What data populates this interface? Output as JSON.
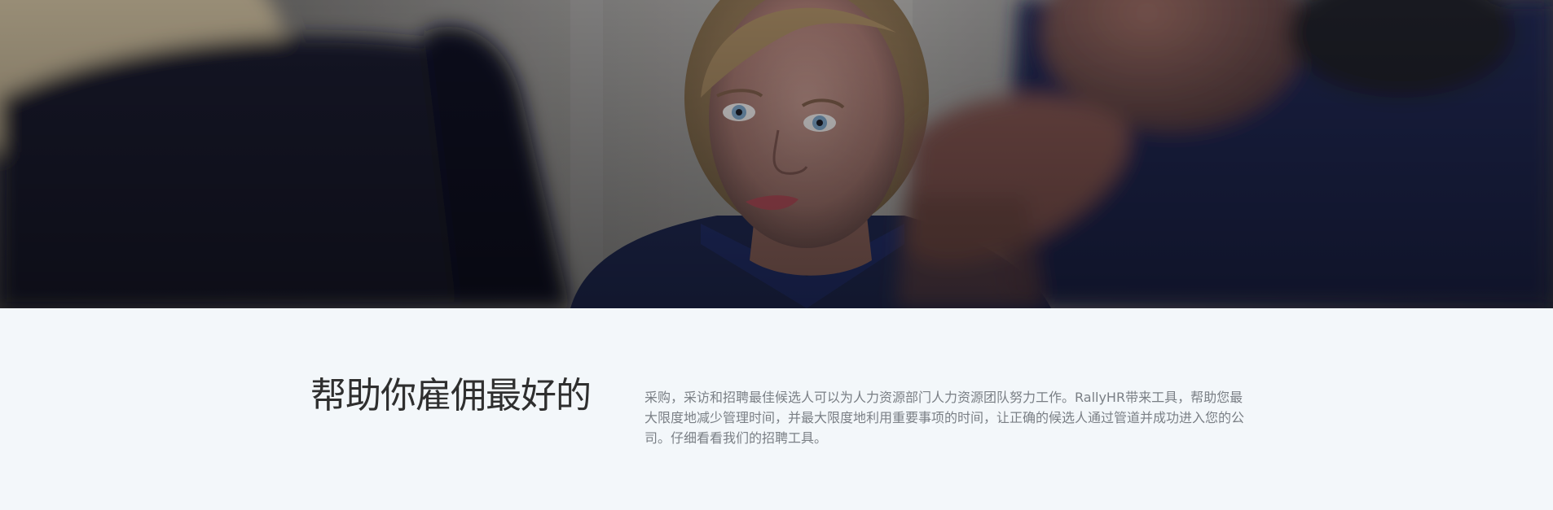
{
  "hero": {
    "image_icon": "interview-photo"
  },
  "intro": {
    "headline": "帮助你雇佣最好的",
    "description": "采购，采访和招聘最佳候选人可以为人力资源部门人力资源团队努力工作。RallyHR带来工具，帮助您最大限度地减少管理时间，并最大限度地利用重要事项的时间，让正确的候选人通过管道并成功进入您的公司。仔细看看我们的招聘工具。"
  },
  "colors": {
    "page_background": "#f3f7fa",
    "headline_text": "#2f2f2f",
    "body_text": "#7a7f85"
  }
}
